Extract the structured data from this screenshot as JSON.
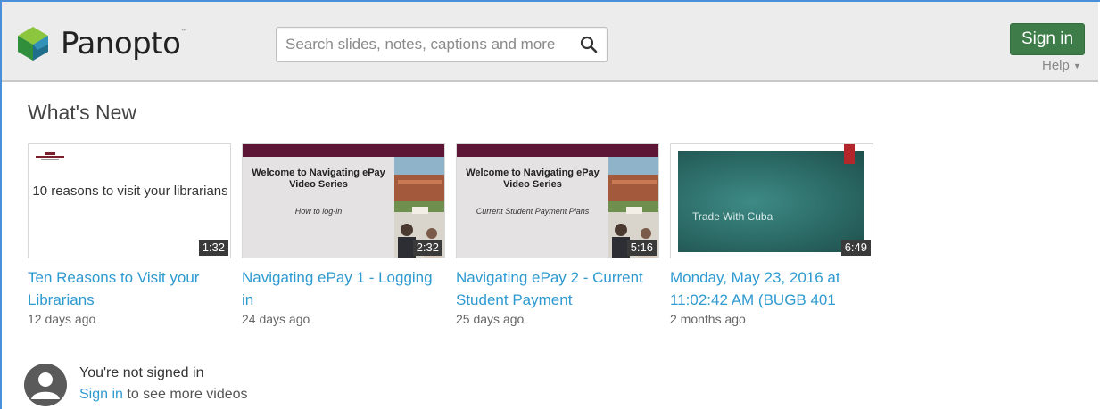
{
  "header": {
    "logo_text": "Panopto",
    "logo_tm": "™",
    "search": {
      "placeholder": "Search slides, notes, captions and more"
    },
    "signin_label": "Sign in",
    "help_label": "Help",
    "brand_color": "#3e7d4a"
  },
  "main": {
    "section_title": "What's New",
    "videos": [
      {
        "thumb_text": "10 reasons to visit your librarians",
        "thumb_logo_text": "COLORADO MESA UNIVERSITY",
        "duration": "1:32",
        "title": "Ten Reasons to Visit your Librarians",
        "date": "12 days ago"
      },
      {
        "thumb_heading": "Welcome to Navigating ePay Video Series",
        "thumb_sub": "How to log-in",
        "duration": "2:32",
        "title": "Navigating ePay 1 - Logging in",
        "date": "24 days ago"
      },
      {
        "thumb_heading": "Welcome to Navigating ePay Video Series",
        "thumb_sub": "Current Student Payment Plans",
        "duration": "5:16",
        "title": "Navigating ePay 2 - Current Student Payment",
        "date": "25 days ago"
      },
      {
        "thumb_heading": "Trade With Cuba",
        "duration": "6:49",
        "title": "Monday, May 23, 2016 at 11:02:42 AM (BUGB 401",
        "date": "2 months ago"
      }
    ]
  },
  "signin_prompt": {
    "title": "You're not signed in",
    "link": "Sign in",
    "rest": " to see more videos"
  }
}
